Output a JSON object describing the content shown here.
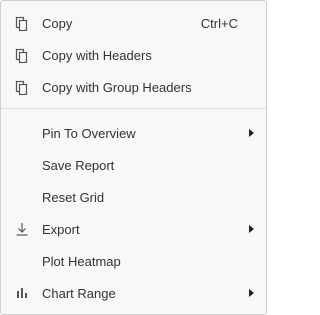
{
  "menu": {
    "copy_items": [
      {
        "label": "Copy",
        "shortcut": "Ctrl+C",
        "icon": "copy-icon"
      },
      {
        "label": "Copy with Headers",
        "icon": "copy-icon"
      },
      {
        "label": "Copy with Group Headers",
        "icon": "copy-icon"
      }
    ],
    "pin_to_overview": "Pin To Overview",
    "save_report": "Save Report",
    "reset_grid": "Reset Grid",
    "export": {
      "label": "Export",
      "icon": "download-icon"
    },
    "plot_heatmap": "Plot Heatmap",
    "chart_range": {
      "label": "Chart Range",
      "icon": "bar-chart-icon"
    }
  },
  "colors": {
    "menu_background": "#f8f8f8",
    "border": "#cfcfcf",
    "text": "#333333",
    "divider": "#dcdcdc"
  }
}
